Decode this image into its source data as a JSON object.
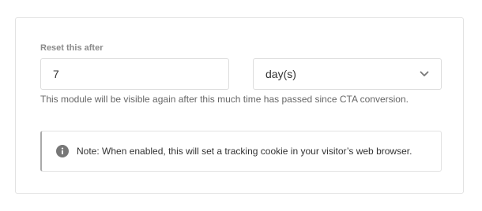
{
  "reset": {
    "label": "Reset this after",
    "value": "7",
    "unit_selected": "day(s)",
    "help_text": "This module will be visible again after this much time has passed since CTA conversion."
  },
  "notice": {
    "icon": "info-icon",
    "text": "Note: When enabled, this will set a tracking cookie in your visitor’s web browser."
  },
  "colors": {
    "border": "#dddddd",
    "label": "#8a8a8a",
    "icon": "#777777"
  }
}
